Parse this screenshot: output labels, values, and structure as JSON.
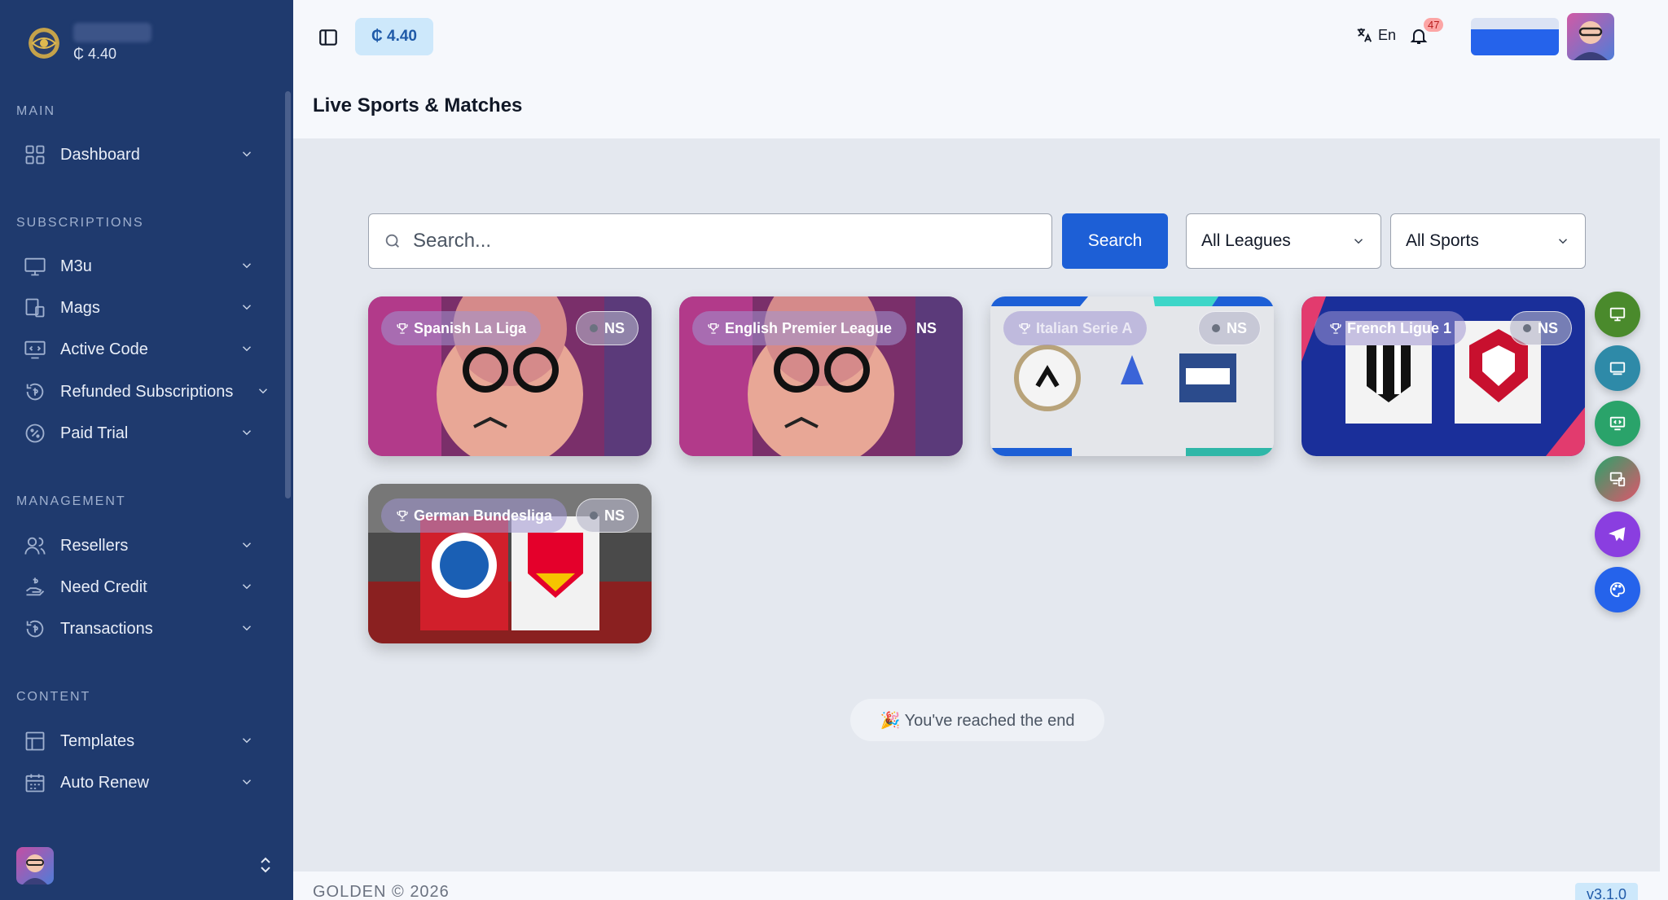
{
  "brand": {
    "credit": "₵ 4.40"
  },
  "sidebar": {
    "sections": {
      "main": "MAIN",
      "subscriptions": "SUBSCRIPTIONS",
      "management": "MANAGEMENT",
      "content": "CONTENT"
    },
    "items": {
      "dashboard": "Dashboard",
      "m3u": "M3u",
      "mags": "Mags",
      "active_code": "Active Code",
      "refunded": "Refunded Subscriptions",
      "paid_trial": "Paid Trial",
      "resellers": "Resellers",
      "need_credit": "Need Credit",
      "transactions": "Transactions",
      "templates": "Templates",
      "auto_renew": "Auto Renew"
    }
  },
  "header": {
    "balance": "₵ 4.40",
    "language": "En",
    "notifications": "47",
    "page_title": "Live Sports & Matches"
  },
  "toolbar": {
    "search_placeholder": "Search...",
    "search_button": "Search",
    "league_select": "All Leagues",
    "sport_select": "All Sports"
  },
  "matches": [
    {
      "league": "Spanish La Liga",
      "status": "NS"
    },
    {
      "league": "English Premier League",
      "status": "NS"
    },
    {
      "league": "Italian Serie A",
      "status": "NS"
    },
    {
      "league": "French Ligue 1",
      "status": "NS"
    },
    {
      "league": "German Bundesliga",
      "status": "NS"
    }
  ],
  "end_message": "🎉  You've reached the end",
  "footer": {
    "copyright": "GOLDEN © 2026",
    "version": "v3.1.0"
  },
  "colors": {
    "sidebar": "#1f3a6e",
    "accent": "#1d5fd6",
    "badge": "#cde8fb"
  }
}
